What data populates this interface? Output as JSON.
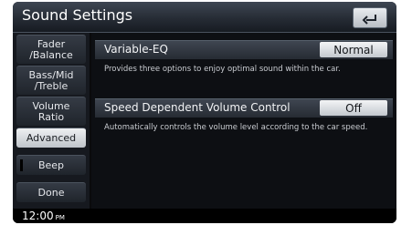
{
  "window": {
    "title": "Sound Settings"
  },
  "sidebar": {
    "items": [
      {
        "label": "Fader\n/Balance"
      },
      {
        "label": "Bass/Mid\n/Treble"
      },
      {
        "label": "Volume\nRatio"
      },
      {
        "label": "Advanced",
        "selected": true
      },
      {
        "label": "Beep"
      },
      {
        "label": "Done"
      }
    ]
  },
  "settings": [
    {
      "label": "Variable-EQ",
      "value": "Normal",
      "description": "Provides three options to enjoy optimal sound within the car."
    },
    {
      "label": "Speed Dependent Volume Control",
      "value": "Off",
      "description": "Automatically controls the volume level according to the car speed."
    }
  ],
  "status": {
    "time": "12:00",
    "ampm": "PM"
  },
  "icons": {
    "back": "back-arrow-icon"
  },
  "colors": {
    "background": "#0a0a0c",
    "active_item": "#e6e9ec",
    "button": "#dfe2e6"
  }
}
